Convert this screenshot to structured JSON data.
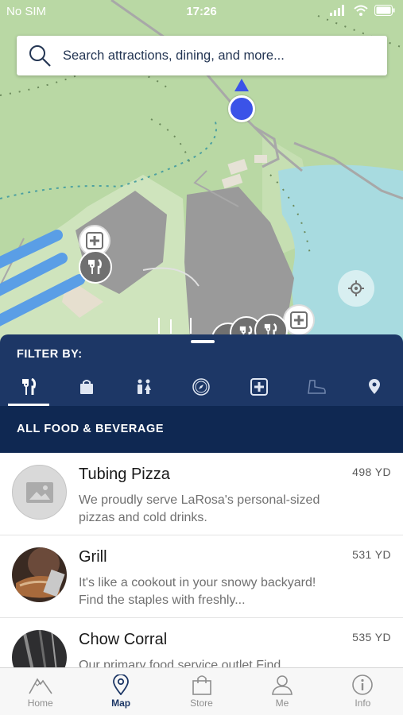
{
  "status_bar": {
    "carrier": "No SIM",
    "time": "17:26"
  },
  "search": {
    "placeholder": "Search attractions, dining, and more..."
  },
  "filter": {
    "label": "FILTER BY:",
    "icons": [
      "fork-knife-icon",
      "shopping-bag-icon",
      "restroom-icon",
      "compass-icon",
      "first-aid-icon",
      "boot-icon",
      "location-pin-icon"
    ],
    "active": "fork-knife-icon"
  },
  "category": {
    "title": "ALL FOOD & BEVERAGE"
  },
  "items": [
    {
      "title": "Tubing Pizza",
      "description": "We proudly serve LaRosa's personal-sized pizzas and cold drinks.",
      "distance": "498 YD"
    },
    {
      "title": "Grill",
      "description": "It's like a cookout in your snowy backyard! Find the staples with freshly...",
      "distance": "531 YD"
    },
    {
      "title": "Chow Corral",
      "description": "Our primary food service outlet Find",
      "distance": "535 YD"
    }
  ],
  "tabs": [
    {
      "label": "Home",
      "icon": "mountain-icon"
    },
    {
      "label": "Map",
      "icon": "map-pin-icon",
      "active": true
    },
    {
      "label": "Store",
      "icon": "shopping-bag-icon"
    },
    {
      "label": "Me",
      "icon": "user-icon"
    },
    {
      "label": "Info",
      "icon": "info-icon"
    }
  ],
  "colors": {
    "navy": "#1d3766",
    "dark_navy": "#0f2852",
    "map_green": "#b9d8a4",
    "water": "#a8dbe0",
    "user_dot": "#3b53e8"
  }
}
